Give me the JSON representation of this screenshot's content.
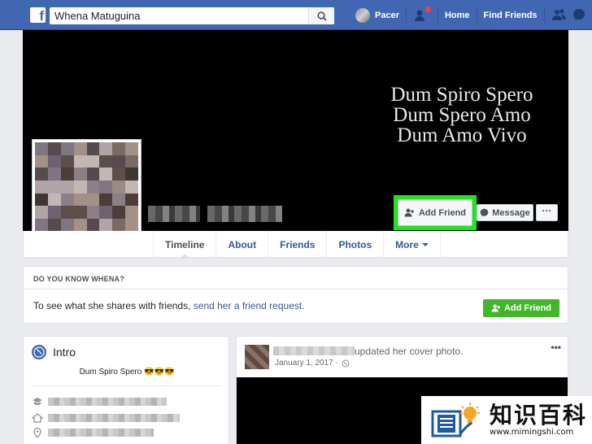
{
  "topbar": {
    "logo": "f",
    "search_value": "Whena Matuguina",
    "user_name": "Pacer",
    "home_label": "Home",
    "find_friends_label": "Find Friends"
  },
  "cover": {
    "quote_lines": [
      "Dum Spiro Spero",
      "Dum Spero Amo",
      "Dum Amo Vivo"
    ]
  },
  "profile_actions": {
    "add_friend_label": "Add Friend",
    "message_label": "Message",
    "more_label": "···"
  },
  "tabs": [
    {
      "label": "Timeline",
      "active": true
    },
    {
      "label": "About"
    },
    {
      "label": "Friends"
    },
    {
      "label": "Photos"
    },
    {
      "label": "More"
    }
  ],
  "do_you_know": {
    "heading": "DO YOU KNOW WHENA?",
    "text_prefix": "To see what she shares with friends,",
    "link_text": "send her a friend request.",
    "button_label": "Add Friend"
  },
  "intro": {
    "title": "Intro",
    "bio": "Dum Spiro Spero 😎😎😎"
  },
  "post": {
    "action_text": "updated her cover photo.",
    "date": "January 1, 2017 ·",
    "options": "•••"
  },
  "watermark": {
    "brand": "知识百科",
    "url": "www.mimingshi.com"
  },
  "colors": {
    "facebook_blue": "#4267b2",
    "highlight_green": "#1fe51f",
    "add_friend_green": "#42b72a",
    "link_blue": "#365899"
  }
}
